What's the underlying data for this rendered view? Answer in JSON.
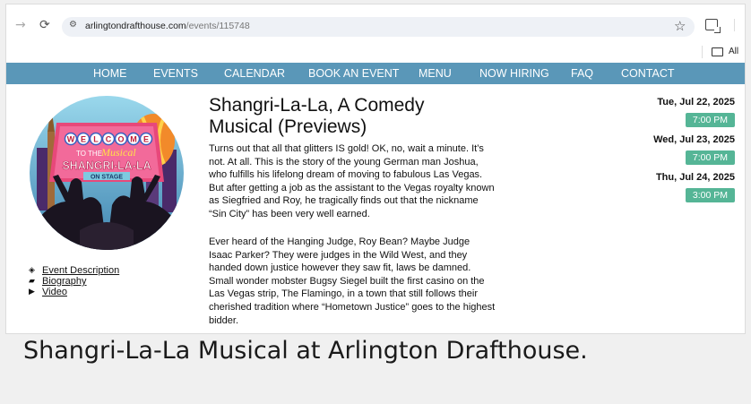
{
  "browser": {
    "url_host": "arlingtondrafthouse.com",
    "url_path": "/events/115748",
    "bookmarks_label": "All",
    "icons": [
      "back-icon",
      "reload-icon",
      "site-info-icon",
      "star-icon",
      "extensions-icon",
      "folder-icon"
    ]
  },
  "nav": {
    "items": [
      "HOME",
      "EVENTS",
      "CALENDAR",
      "BOOK AN EVENT",
      "MENU",
      "NOW HIRING",
      "FAQ",
      "CONTACT"
    ]
  },
  "poster": {
    "welcome_letters": [
      "W",
      "E",
      "L",
      "C",
      "O",
      "M",
      "E"
    ],
    "to_the": "TO THE",
    "musical": "Musical",
    "show_name": "SHANGRI-LA-LA",
    "on_stage": "ON STAGE"
  },
  "event": {
    "title": "Shangri-La-La, A Comedy Musical (Previews)",
    "paragraph1": "Turns out that all that glitters IS gold! OK, no, wait a minute. It’s not. At all. This is the story of the young German man Joshua, who fulfills his lifelong dream of moving to fabulous Las Vegas. But after getting a job as the assistant to the Vegas royalty known as Siegfried and Roy, he tragically finds out that the nickname “Sin City” has been very well earned.",
    "paragraph2": "Ever heard of the Hanging Judge, Roy Bean? Maybe Judge Isaac Parker? They were judges in the Wild West, and they handed down justice however they saw fit, laws be damned. Small wonder mobster Bugsy Siegel built the first casino on the Las Vegas strip, The Flamingo, in a town that still follows their cherished tradition where “Hometown Justice” goes to the highest bidder."
  },
  "links": [
    {
      "icon": "tag-icon",
      "label": "Event Description"
    },
    {
      "icon": "book-icon",
      "label": "Biography"
    },
    {
      "icon": "video-icon",
      "label": "Video"
    }
  ],
  "showtimes": [
    {
      "date": "Tue, Jul 22, 2025",
      "time": "7:00 PM"
    },
    {
      "date": "Wed, Jul 23, 2025",
      "time": "7:00 PM"
    },
    {
      "date": "Thu, Jul 24, 2025",
      "time": "3:00 PM"
    }
  ],
  "colors": {
    "nav_bar": "#5a97b8",
    "showtime_button": "#55b596",
    "poster_pink": "#e8487a",
    "poster_sky": "#7ecae0"
  },
  "caption": "Shangri-La-La Musical at Arlington Drafthouse."
}
